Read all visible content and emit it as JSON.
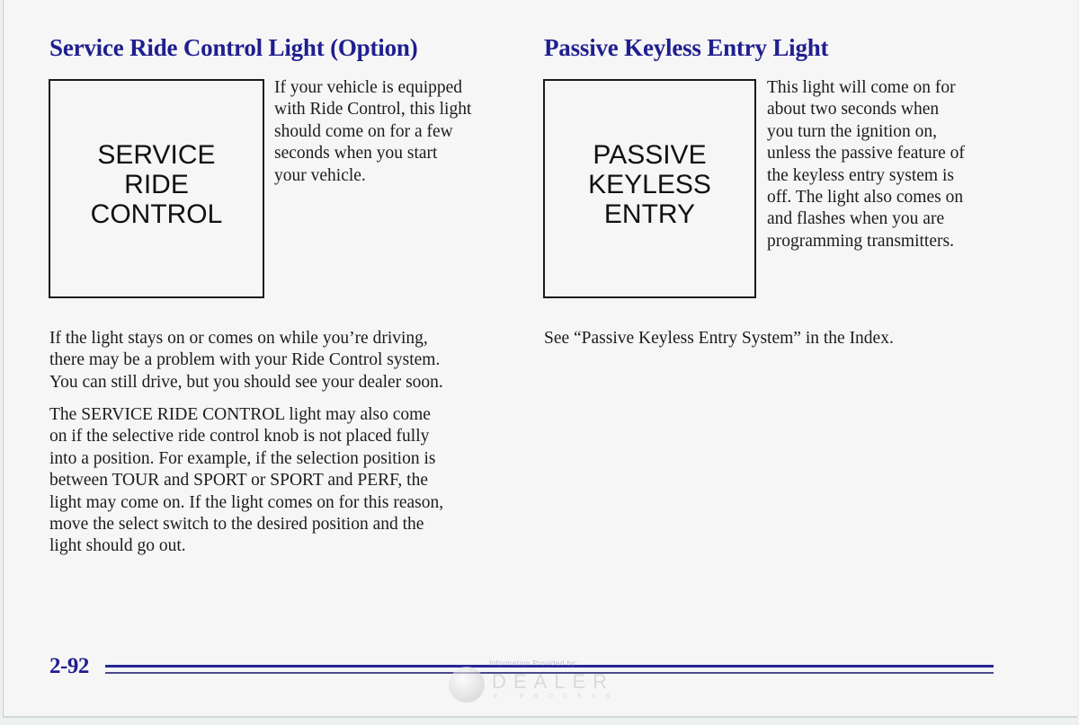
{
  "left_section": {
    "heading": "Service Ride Control Light (Option)",
    "indicator_lines": [
      "SERVICE",
      "RIDE",
      "CONTROL"
    ],
    "side_text_lines": [
      "If your vehicle is equipped",
      "with Ride Control, this light",
      "should come on for a few",
      "seconds when you start",
      "your vehicle."
    ],
    "para1_lines": [
      "If the light stays on or comes on while you’re driving,",
      "there may be a problem with your Ride Control system.",
      "You can still drive, but you should see your dealer soon."
    ],
    "para2_lines": [
      "The SERVICE RIDE CONTROL light may also come",
      "on if the selective ride control knob is not placed fully",
      "into a position. For example, if the selection position is",
      "between TOUR and SPORT or SPORT and PERF, the",
      "light may come on. If the light comes on for this reason,",
      "move the select switch to the desired position and the",
      "light should go out."
    ]
  },
  "right_section": {
    "heading": "Passive Keyless Entry Light",
    "indicator_lines": [
      "PASSIVE",
      "KEYLESS",
      "ENTRY"
    ],
    "side_text_lines": [
      "This light will come on for",
      "about two seconds when",
      "you turn the ignition on,",
      "unless the passive feature of",
      "the keyless entry system is",
      "off. The light also comes on",
      "and flashes when you are",
      "programming transmitters."
    ],
    "para1_lines": [
      "See “Passive Keyless Entry System” in the Index."
    ]
  },
  "footer": {
    "page_number": "2-92",
    "watermark": {
      "small_text": "Information Provided by:",
      "brand": "DEALER",
      "sub": "E-PROCESS"
    }
  },
  "colors": {
    "heading": "#1f1f8f",
    "rule": "#26269a",
    "body_text": "#1c1c1c"
  }
}
